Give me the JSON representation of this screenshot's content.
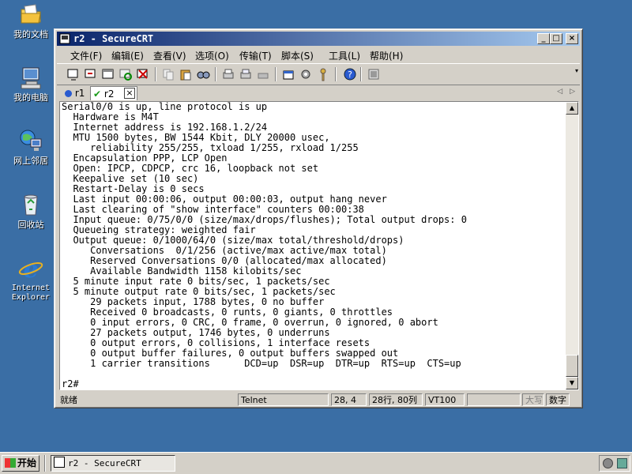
{
  "desktop": {
    "icons": [
      {
        "label": "我的文档",
        "icon": "my-documents-icon"
      },
      {
        "label": "我的电脑",
        "icon": "my-computer-icon"
      },
      {
        "label": "网上邻居",
        "icon": "network-icon"
      },
      {
        "label": "回收站",
        "icon": "recycle-bin-icon"
      },
      {
        "label": "Internet\nExplorer",
        "icon": "internet-explorer-icon"
      }
    ]
  },
  "window": {
    "title": "r2 - SecureCRT",
    "menu": [
      "文件(F)",
      "编辑(E)",
      "查看(V)",
      "选项(O)",
      "传输(T)",
      "脚本(S)",
      "工具(L)",
      "帮助(H)"
    ],
    "tabs": [
      {
        "label": "r1",
        "status": "info"
      },
      {
        "label": "r2",
        "status": "connected"
      }
    ],
    "terminal_lines": [
      "Serial0/0 is up, line protocol is up",
      "  Hardware is M4T",
      "  Internet address is 192.168.1.2/24",
      "  MTU 1500 bytes, BW 1544 Kbit, DLY 20000 usec,",
      "     reliability 255/255, txload 1/255, rxload 1/255",
      "  Encapsulation PPP, LCP Open",
      "  Open: IPCP, CDPCP, crc 16, loopback not set",
      "  Keepalive set (10 sec)",
      "  Restart-Delay is 0 secs",
      "  Last input 00:00:06, output 00:00:03, output hang never",
      "  Last clearing of \"show interface\" counters 00:00:38",
      "  Input queue: 0/75/0/0 (size/max/drops/flushes); Total output drops: 0",
      "  Queueing strategy: weighted fair",
      "  Output queue: 0/1000/64/0 (size/max total/threshold/drops)",
      "     Conversations  0/1/256 (active/max active/max total)",
      "     Reserved Conversations 0/0 (allocated/max allocated)",
      "     Available Bandwidth 1158 kilobits/sec",
      "  5 minute input rate 0 bits/sec, 1 packets/sec",
      "  5 minute output rate 0 bits/sec, 1 packets/sec",
      "     29 packets input, 1788 bytes, 0 no buffer",
      "     Received 0 broadcasts, 0 runts, 0 giants, 0 throttles",
      "     0 input errors, 0 CRC, 0 frame, 0 overrun, 0 ignored, 0 abort",
      "     27 packets output, 1746 bytes, 0 underruns",
      "     0 output errors, 0 collisions, 1 interface resets",
      "     0 output buffer failures, 0 output buffers swapped out",
      "     1 carrier transitions      DCD=up  DSR=up  DTR=up  RTS=up  CTS=up"
    ],
    "prompt": "r2#",
    "status": {
      "ready": "就绪",
      "protocol": "Telnet",
      "cursor": "28,  4",
      "rows_cols": "28行, 80列",
      "emulation": "VT100",
      "caps": "大写",
      "num": "数字"
    }
  },
  "taskbar": {
    "start": "开始",
    "items": [
      {
        "label": "r2 - SecureCRT"
      }
    ]
  }
}
